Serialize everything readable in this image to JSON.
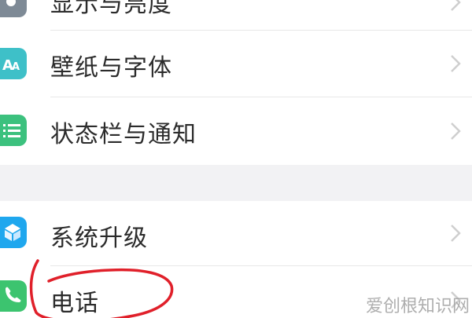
{
  "settings": {
    "items": [
      {
        "label": "显示与亮度",
        "icon": "brightness-icon",
        "color": "#7e8a96"
      },
      {
        "label": "壁纸与字体",
        "icon": "wallpaper-font-icon",
        "color": "#3ec0c8"
      },
      {
        "label": "状态栏与通知",
        "icon": "statusbar-notification-icon",
        "color": "#3cc17e"
      },
      {
        "label": "系统升级",
        "icon": "system-update-icon",
        "color": "#1fa7ee"
      },
      {
        "label": "电话",
        "icon": "phone-icon",
        "color": "#3cc46f"
      }
    ]
  },
  "annotation": {
    "color": "#e0202a"
  },
  "watermark": {
    "text": "爱创根知识网"
  }
}
